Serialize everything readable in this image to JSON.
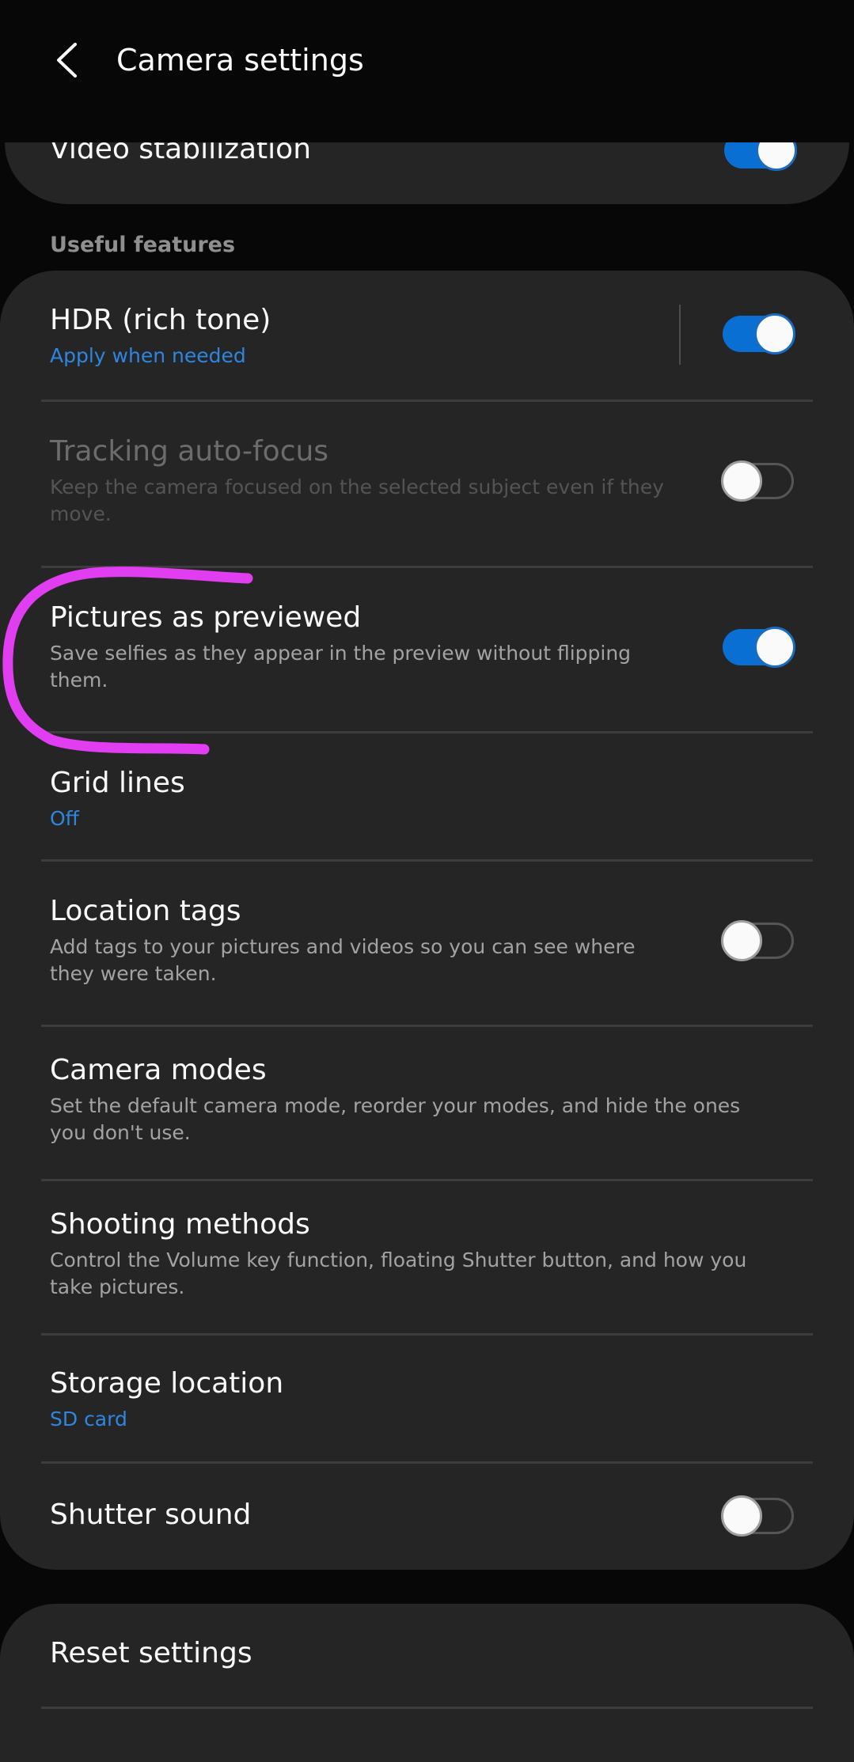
{
  "header": {
    "back_icon": "chevron-left-icon",
    "title": "Camera settings"
  },
  "partial_item": {
    "label": "Video stabilization",
    "toggle_on": true
  },
  "section": {
    "title": "Useful features"
  },
  "items": [
    {
      "label": "HDR (rich tone)",
      "sub": "Apply when needed",
      "sub_style": "accent",
      "toggle_on": true,
      "has_separator": true,
      "enabled": true
    },
    {
      "label": "Tracking auto-focus",
      "sub": "Keep the camera focused on the selected subject even if they move.",
      "toggle_on": false,
      "enabled": false
    },
    {
      "label": "Pictures as previewed",
      "sub": "Save selfies as they appear in the preview without flipping them.",
      "toggle_on": true,
      "enabled": true,
      "annotated": true
    },
    {
      "label": "Grid lines",
      "sub": "Off",
      "sub_style": "accent",
      "enabled": true
    },
    {
      "label": "Location tags",
      "sub": "Add tags to your pictures and videos so you can see where they were taken.",
      "toggle_on": false,
      "enabled": true
    },
    {
      "label": "Camera modes",
      "sub": "Set the default camera mode, reorder your modes, and hide the ones you don't use.",
      "enabled": true
    },
    {
      "label": "Shooting methods",
      "sub": "Control the Volume key function, floating Shutter button, and how you take pictures.",
      "enabled": true
    },
    {
      "label": "Storage location",
      "sub": "SD card",
      "sub_style": "accent",
      "enabled": true
    },
    {
      "label": "Shutter sound",
      "toggle_on": false,
      "enabled": true
    }
  ],
  "reset": {
    "label": "Reset settings"
  },
  "colors": {
    "accent": "#2d86e0",
    "toggle_on": "#0a6fd3",
    "card_bg": "#252525",
    "page_bg": "#070707",
    "annotation": "#e03ef0"
  }
}
